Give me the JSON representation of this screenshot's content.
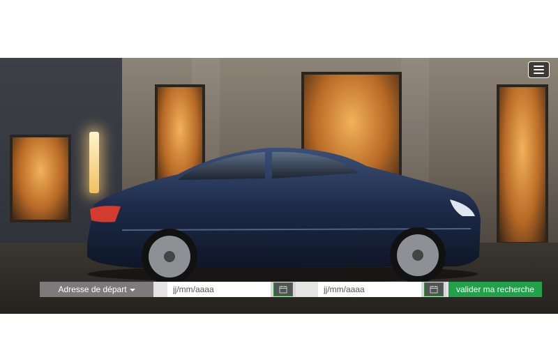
{
  "header": {
    "menu_icon": "hamburger-menu-icon"
  },
  "hero": {
    "description_icon": "car-photo"
  },
  "search": {
    "departure_label": "Adresse de départ",
    "start_date_placeholder": "jj/mm/aaaa",
    "end_date_placeholder": "jj/mm/aaaa",
    "calendar_icon": "calendar-icon",
    "submit_label": "valider ma recherche",
    "colors": {
      "dropdown_bg": "#7b7b7b",
      "submit_bg": "#21a24a",
      "calendar_border": "#2c8f3c"
    }
  }
}
